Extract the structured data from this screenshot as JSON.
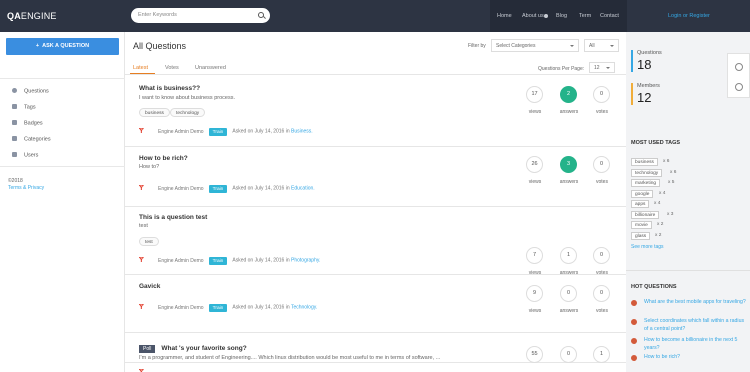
{
  "header": {
    "logo_bold": "QA",
    "logo_thin": "ENGINE",
    "search_placeholder": "Enter Keywords",
    "nav": [
      "Home",
      "About us",
      "Blog",
      "Term",
      "Contact"
    ],
    "login": "Login or Register"
  },
  "sidebar": {
    "ask_button": "ASK A QUESTION",
    "items": [
      {
        "label": "Questions",
        "icon": "question-icon"
      },
      {
        "label": "Tags",
        "icon": "tag-icon"
      },
      {
        "label": "Badges",
        "icon": "badge-icon"
      },
      {
        "label": "Categories",
        "icon": "categories-icon"
      },
      {
        "label": "Users",
        "icon": "users-icon"
      }
    ],
    "copyright": "©2018",
    "terms": "Terms & Privacy"
  },
  "main": {
    "title": "All Questions",
    "filter_by": "Filter by",
    "category_select": "Select Categories",
    "all_select": "All",
    "tabs": [
      "Latest",
      "Votes",
      "Unanswered"
    ],
    "qpp_label": "Questions Per Page:",
    "qpp_value": "12",
    "stat_labels": {
      "views": "views",
      "answers": "answers",
      "votes": "votes"
    },
    "train": "Train",
    "questions": [
      {
        "title": "What is business??",
        "excerpt": "I want to know about business process.",
        "tags": [
          "business",
          "technology"
        ],
        "user": "Engine Admin Demo",
        "asked": "Asked on July 14, 2016 in",
        "category": "Business.",
        "views": "17",
        "answers": "2",
        "votes": "0",
        "answered": true
      },
      {
        "title": "How to be rich?",
        "excerpt": "How to?",
        "tags": [],
        "user": "Engine Admin Demo",
        "asked": "Asked on July 14, 2016 in",
        "category": "Education.",
        "views": "26",
        "answers": "3",
        "votes": "0",
        "answered": true
      },
      {
        "title": "This is a question test",
        "excerpt": "test",
        "tags": [
          "test"
        ],
        "user": "Engine Admin Demo",
        "asked": "Asked on July 14, 2016 in",
        "category": "Photography.",
        "views": "7",
        "answers": "1",
        "votes": "0",
        "answered": false
      },
      {
        "title": "Gavick",
        "excerpt": "",
        "tags": [],
        "user": "Engine Admin Demo",
        "asked": "Asked on July 14, 2016 in",
        "category": "Technology.",
        "views": "9",
        "answers": "0",
        "votes": "0",
        "answered": false
      },
      {
        "poll": "Poll",
        "title": "What 's your favorite song?",
        "excerpt": "I'm a programmer, and student of Engineering.... Which linux distribution would be most useful to me in terms of software, ...",
        "tags": [],
        "views": "55",
        "answers": "0",
        "votes": "1",
        "answered": false
      }
    ]
  },
  "rightbar": {
    "questions_label": "Questions",
    "questions_count": "18",
    "members_label": "Members",
    "members_count": "12",
    "most_used_tags_title": "MOST USED TAGS",
    "tags": [
      {
        "name": "business",
        "count": "x 6"
      },
      {
        "name": "technology",
        "count": "x 6"
      },
      {
        "name": "marketing",
        "count": "x 5"
      },
      {
        "name": "google",
        "count": "x 4"
      },
      {
        "name": "apps",
        "count": "x 4"
      },
      {
        "name": "billionaire",
        "count": "x 3"
      },
      {
        "name": "movie",
        "count": "x 2"
      },
      {
        "name": "glass",
        "count": "x 2"
      }
    ],
    "see_more": "See more tags",
    "hot_title": "HOT QUESTIONS",
    "hot": [
      "What are the best mobile apps for traveling?",
      "Select coordinates which fall within a radius of a central point?",
      "How to become a billionaire in the next 5 years?",
      "How to be rich?"
    ]
  },
  "colors": {
    "accent_orange": "#e67e22",
    "answered_green": "#24b38a",
    "link_blue": "#35a7e4",
    "header": "#2d3443"
  }
}
